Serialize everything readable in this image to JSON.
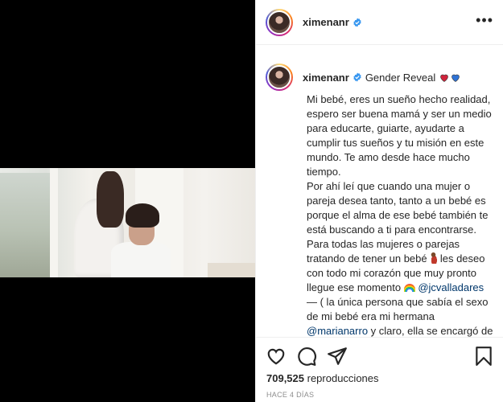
{
  "post": {
    "username": "ximenanr",
    "verified": true,
    "more_label": "•••"
  },
  "caption": {
    "username": "ximenanr",
    "title": "Gender Reveal",
    "line1": "Mi bebé, eres un sueño hecho realidad, espero ser buena mamá y ser un medio para educarte, guiarte, ayudarte a cumplir tus sueños y tu misión en este mundo. Te amo desde hace mucho tiempo.",
    "line2": "Por ahí leí que cuando una mujer o pareja desea tanto, tanto a un bebé es porque el alma de ese bebé también te está buscando a ti para encontrarse.",
    "line3_a": "Para todas las mujeres o parejas tratando de tener un bebé ",
    "line3_b": " les deseo con todo mi corazón que muy pronto llegue ese momento ",
    "mention1": "@jcvalladares",
    "line4_a": "— ( la única persona que sabía el sexo de mi bebé era mi hermana ",
    "mention2": "@marianarro",
    "line4_b": " y claro, ella se encargó de llevar humos de muchos colores"
  },
  "stats": {
    "views_count": "709,525",
    "views_label": "reproducciones",
    "time_ago": "HACE 4 DÍAS"
  },
  "colors": {
    "verified": "#3897f0",
    "heart_red": "#d0233b",
    "heart_blue": "#2f73d6",
    "mention": "#00376b"
  },
  "icons": [
    "heart-icon",
    "comment-icon",
    "share-icon",
    "bookmark-icon",
    "verified-badge-icon",
    "more-options-icon"
  ]
}
